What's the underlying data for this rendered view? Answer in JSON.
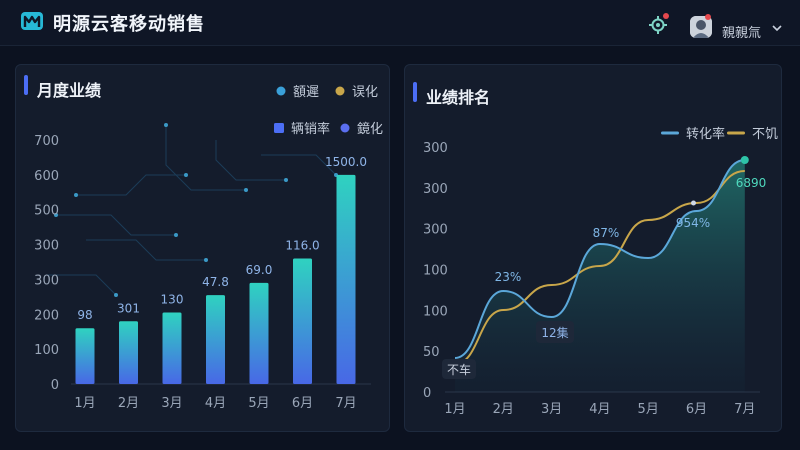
{
  "app": {
    "title": "明源云客移动销售",
    "user_name": "親親氚"
  },
  "colors": {
    "accent": "#4c6ef5",
    "bar_top": "#2fd2c0",
    "bar_bottom": "#4868e6",
    "line_blue": "#5ba7d9",
    "line_gold": "#c8a64a",
    "teal": "#2ec4a8"
  },
  "icons": {
    "logo": "app-logo-icon",
    "settings": "settings-icon",
    "avatar": "avatar",
    "dropdown": "chevron-down-icon"
  },
  "left_panel": {
    "title": "月度业绩",
    "legend": [
      {
        "label": "額遲",
        "color": "#3aa0d9",
        "marker": "circle"
      },
      {
        "label": "误化",
        "color": "#c8a64a",
        "marker": "circle"
      },
      {
        "label": "辆销率",
        "color": "#4c6ef5",
        "marker": "square"
      },
      {
        "label": "鏡化",
        "color": "#5b6ff0",
        "marker": "circle"
      }
    ]
  },
  "right_panel": {
    "title": "业绩排名",
    "legend": [
      {
        "label": "转化率",
        "color": "#5ba7d9",
        "marker": "line"
      },
      {
        "label": "不饥",
        "color": "#c8a64a",
        "marker": "line"
      }
    ]
  },
  "chart_data": [
    {
      "type": "bar",
      "title": "月度业绩",
      "categories": [
        "1月",
        "2月",
        "3月",
        "4月",
        "5月",
        "6月",
        "7月"
      ],
      "values": [
        160,
        180,
        205,
        255,
        290,
        360,
        600
      ],
      "data_labels": [
        "98",
        "301",
        "130",
        "47.8",
        "69.0",
        "116.0",
        "1500.0"
      ],
      "y_ticks": [
        "0",
        "100",
        "200",
        "300",
        "300",
        "500",
        "600",
        "700"
      ],
      "ylim": [
        0,
        700
      ],
      "grid": false
    },
    {
      "type": "line",
      "title": "业绩排名",
      "categories": [
        "1月",
        "2月",
        "3月",
        "4月",
        "5月",
        "6月",
        "7月"
      ],
      "y_ticks": [
        "0",
        "50",
        "100",
        "100",
        "300",
        "300",
        "300"
      ],
      "series": [
        {
          "name": "转化率",
          "values": [
            34,
            101,
            75,
            148,
            134,
            181,
            232
          ]
        },
        {
          "name": "不饥",
          "values": [
            28,
            82,
            107,
            126,
            172,
            189,
            221
          ]
        }
      ],
      "annotations": [
        "不车",
        "23%",
        "12集",
        "87%",
        "954%",
        "6890"
      ],
      "grid": false
    }
  ]
}
